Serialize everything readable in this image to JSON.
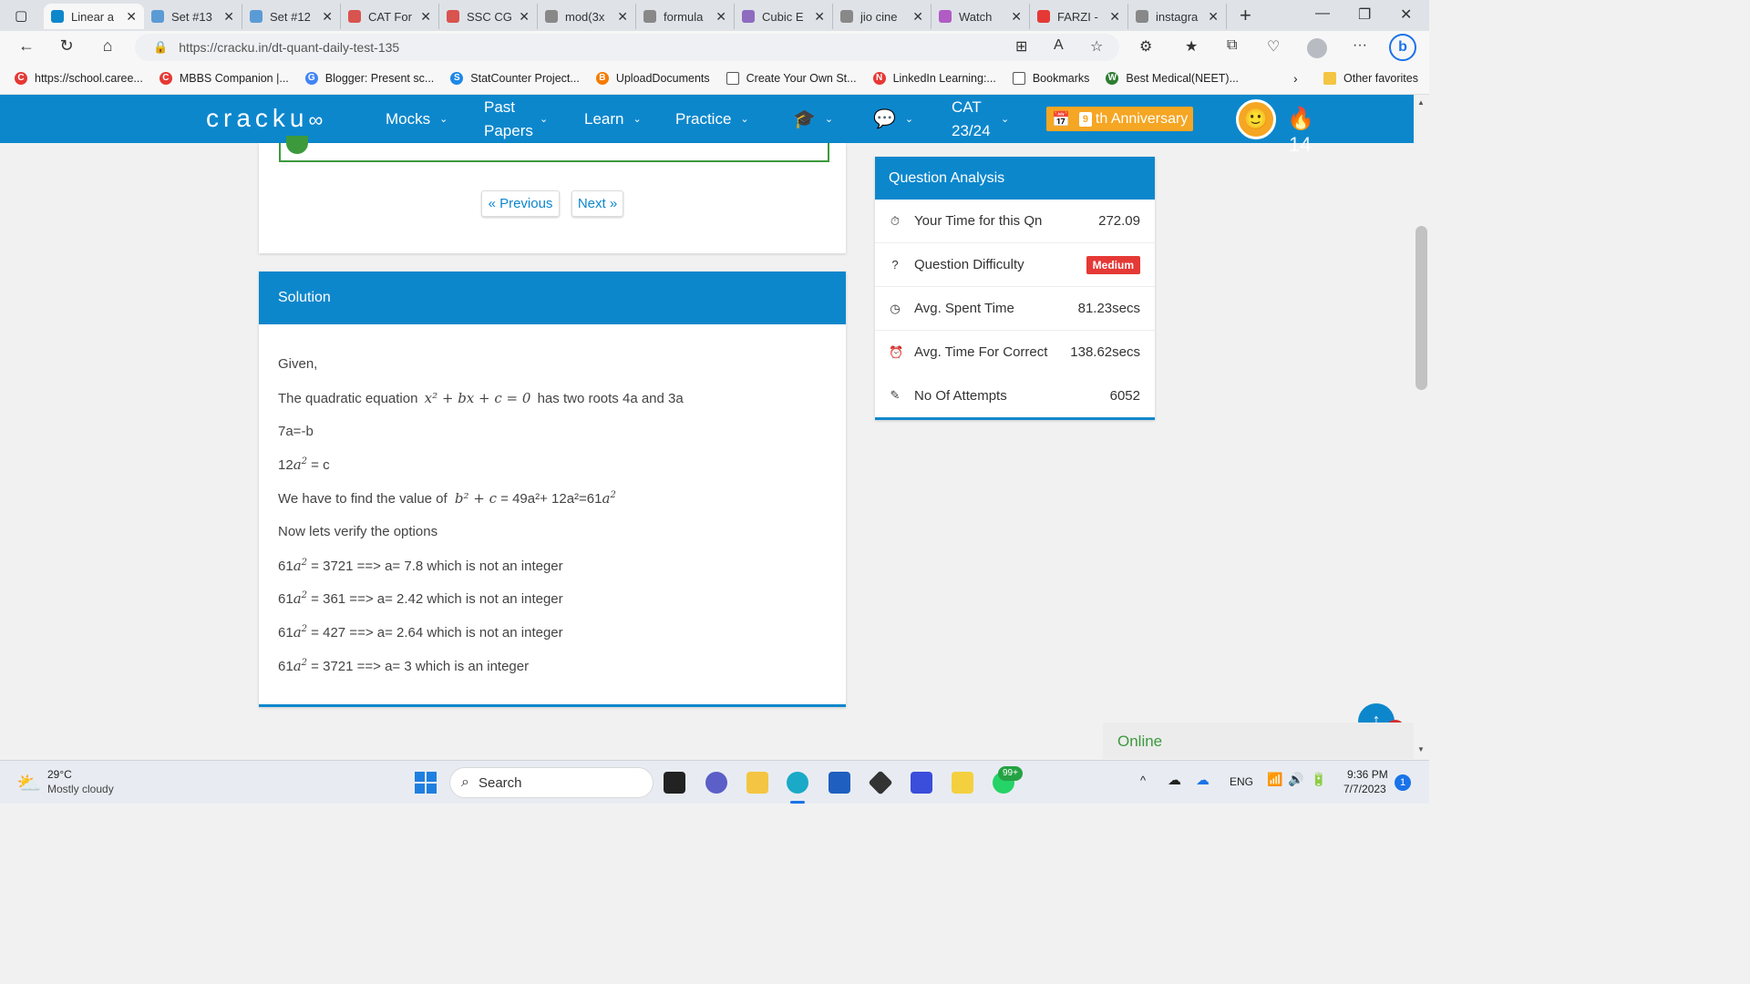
{
  "tabs": [
    {
      "label": "Linear a",
      "color": "#0d87cc",
      "active": true
    },
    {
      "label": "Set #13",
      "color": "#5b9bd5"
    },
    {
      "label": "Set #12",
      "color": "#5b9bd5"
    },
    {
      "label": "CAT For",
      "color": "#d9534f"
    },
    {
      "label": "SSC CG",
      "color": "#d9534f"
    },
    {
      "label": "mod(3x",
      "color": "#888888"
    },
    {
      "label": "formula",
      "color": "#888888"
    },
    {
      "label": "Cubic E",
      "color": "#8e6bbf"
    },
    {
      "label": "jio cine",
      "color": "#888888"
    },
    {
      "label": "Watch",
      "color": "#b05cc4"
    },
    {
      "label": "FARZI -",
      "color": "#e53935"
    },
    {
      "label": "instagra",
      "color": "#888888"
    }
  ],
  "address": {
    "url": "https://cracku.in/dt-quant-daily-test-135"
  },
  "favorites": [
    {
      "label": "https://school.caree...",
      "color": "#e53935",
      "letter": "C"
    },
    {
      "label": "MBBS Companion |...",
      "color": "#e53935",
      "letter": "C"
    },
    {
      "label": "Blogger: Present sc...",
      "color": "#4285f4",
      "letter": "G"
    },
    {
      "label": "StatCounter Project...",
      "color": "#1e88e5",
      "letter": "S"
    },
    {
      "label": "UploadDocuments",
      "color": "#f57c00",
      "letter": "B"
    },
    {
      "label": "Create Your Own St...",
      "color": "#ffffff",
      "letter": ""
    },
    {
      "label": "LinkedIn Learning:...",
      "color": "#e53935",
      "letter": "N"
    },
    {
      "label": "Bookmarks",
      "color": "#ffffff",
      "letter": ""
    },
    {
      "label": "Best Medical(NEET)...",
      "color": "#2e7d32",
      "letter": "W"
    }
  ],
  "other_favorites": "Other favorites",
  "site": {
    "logo": "cracku",
    "nav": {
      "mocks": "Mocks",
      "past_papers_1": "Past",
      "past_papers_2": "Papers",
      "learn": "Learn",
      "practice": "Practice",
      "cat_1": "CAT",
      "cat_2": "23/24"
    },
    "anniversary_num": "9",
    "anniversary_text": "th Anniversary",
    "streak": "14"
  },
  "pager": {
    "prev": "« Previous",
    "next": "Next »"
  },
  "solution": {
    "title": "Solution",
    "given": "Given,",
    "eq_prefix": "The quadratic equation",
    "eq_math": "x² + bx + c = 0",
    "eq_suffix": "has two roots 4a and 3a",
    "l1": "7a=-b",
    "l2_a": "12",
    "l2_b": " = c",
    "l3_prefix": "We have to find the value of",
    "l3_math": "b² + c",
    "l3_rest": " = 49a²+ 12a²=61",
    "l4": "Now lets verify the options",
    "options": [
      " = 3721 ==> a= 7.8 which is not an integer",
      " = 361 ==> a= 2.42 which is not an integer",
      " = 427 ==> a= 2.64 which is not an integer",
      " = 3721 ==> a= 3 which is an integer"
    ],
    "opt_prefix": "61"
  },
  "analysis": {
    "title": "Question Analysis",
    "your_time_label": "Your Time for this Qn",
    "your_time": "272.09",
    "difficulty_label": "Question Difficulty",
    "difficulty": "Medium",
    "avg_spent_label": "Avg. Spent Time",
    "avg_spent": "81.23secs",
    "avg_correct_label": "Avg. Time For Correct",
    "avg_correct": "138.62secs",
    "attempts_label": "No Of Attempts",
    "attempts": "6052"
  },
  "chat": {
    "status": "Online",
    "notif": "1"
  },
  "taskbar": {
    "temp": "29°C",
    "weather": "Mostly cloudy",
    "search": "Search",
    "lang": "ENG",
    "time": "9:36 PM",
    "date": "7/7/2023",
    "notif": "1",
    "whatsapp_badge": "99+"
  }
}
